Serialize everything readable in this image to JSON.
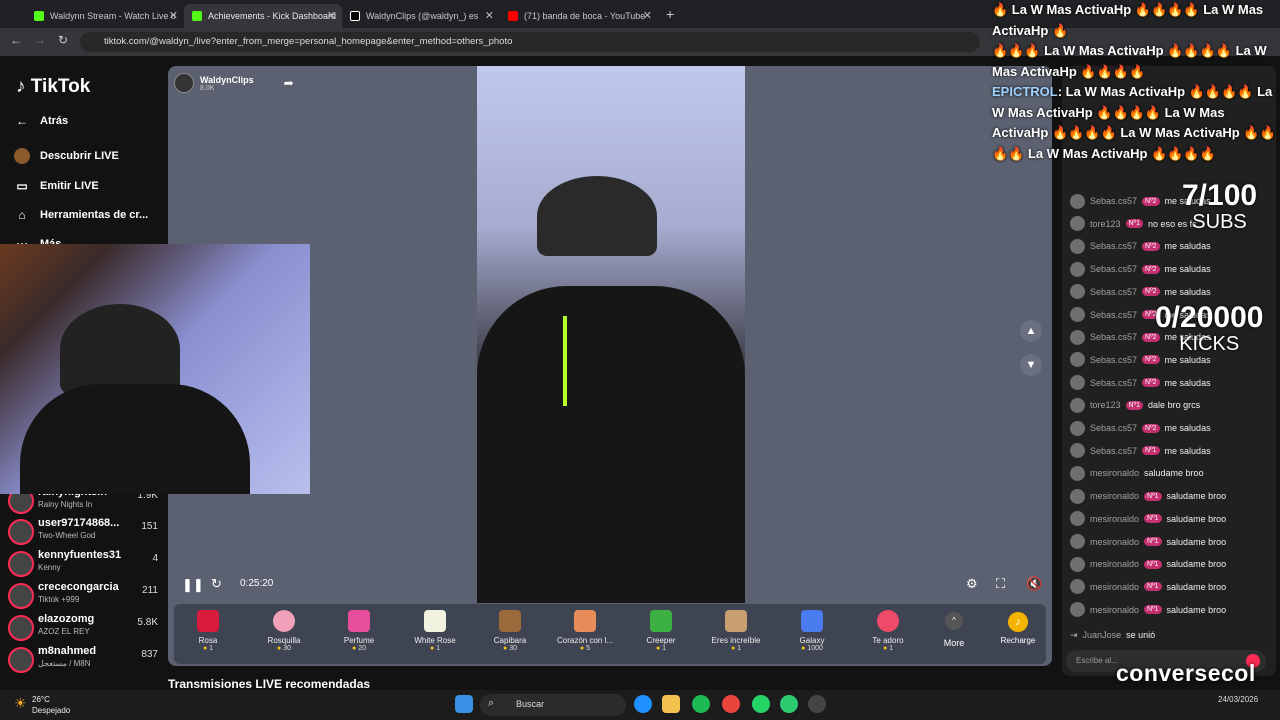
{
  "browser": {
    "tabs": [
      {
        "title": "Waldynn Stream - Watch Live o",
        "active": false
      },
      {
        "title": "Achievements - Kick Dashboard",
        "active": true
      },
      {
        "title": "WaldynClips (@waldyn_) es",
        "active": false
      },
      {
        "title": "(71) banda de boca - YouTube",
        "active": false
      }
    ],
    "url": "tiktok.com/@waldyn_/live?enter_from_merge=personal_homepage&enter_method=others_photo"
  },
  "sidebar": {
    "logo": "TikTok",
    "back": "Atrás",
    "items": [
      {
        "label": "Descubrir LIVE",
        "icon": "avatar-icon"
      },
      {
        "label": "Emitir LIVE",
        "icon": "camera-icon"
      },
      {
        "label": "Herramientas de cr...",
        "icon": "home-icon"
      },
      {
        "label": "Más",
        "icon": "more-icon"
      }
    ],
    "viewers": [
      {
        "name": "rainynightsin",
        "sub": "Rainy Nights In",
        "count": "1.9K"
      },
      {
        "name": "user97174868...",
        "sub": "Two-Wheel God",
        "count": "151"
      },
      {
        "name": "kennyfuentes31",
        "sub": "Kenny",
        "count": "4"
      },
      {
        "name": "crececongarcia",
        "sub": "Tiktok +999",
        "count": "211"
      },
      {
        "name": "elazozomg",
        "sub": "AZOZ EL REY",
        "count": "5.8K"
      },
      {
        "name": "m8nahmed",
        "sub": "مستعجل / M8N",
        "count": "837"
      }
    ]
  },
  "streamer": {
    "name": "WaldynClips",
    "followers": "8.0K"
  },
  "player": {
    "time": "0:25:20"
  },
  "gifts": [
    {
      "name": "Rosa",
      "price": "1",
      "color": "#d81b3c"
    },
    {
      "name": "Rosquilla",
      "price": "30",
      "color": "#f0a0b8"
    },
    {
      "name": "Perfume",
      "price": "20",
      "color": "#e84d9c"
    },
    {
      "name": "White Rose",
      "price": "1",
      "color": "#f2f2e0"
    },
    {
      "name": "Capibara",
      "price": "30",
      "color": "#9a6a3a"
    },
    {
      "name": "Corazón con l...",
      "price": "5",
      "color": "#e88c5a"
    },
    {
      "name": "Creeper",
      "price": "1",
      "color": "#3cb043"
    },
    {
      "name": "Eres increíble",
      "price": "1",
      "color": "#c8a070"
    },
    {
      "name": "Galaxy",
      "price": "1000",
      "color": "#4a7cf0"
    },
    {
      "name": "Te adoro",
      "price": "1",
      "color": "#f04a6a"
    }
  ],
  "more_label": "More",
  "recharge_label": "Recharge",
  "recommended_title": "Transmisiones LIVE recomendadas",
  "chat": {
    "messages": [
      {
        "user": "Sebas.cs57",
        "badge": "Nº2",
        "text": "me saludas"
      },
      {
        "user": "tore123",
        "badge": "Nº1",
        "text": "no eso es fc"
      },
      {
        "user": "Sebas.cs57",
        "badge": "Nº2",
        "text": "me saludas"
      },
      {
        "user": "Sebas.cs57",
        "badge": "Nº2",
        "text": "me saludas"
      },
      {
        "user": "Sebas.cs57",
        "badge": "Nº2",
        "text": "me saludas"
      },
      {
        "user": "Sebas.cs57",
        "badge": "Nº2",
        "text": "me saludas"
      },
      {
        "user": "Sebas.cs57",
        "badge": "Nº2",
        "text": "me saludas"
      },
      {
        "user": "Sebas.cs57",
        "badge": "Nº2",
        "text": "me saludas"
      },
      {
        "user": "Sebas.cs57",
        "badge": "Nº2",
        "text": "me saludas"
      },
      {
        "user": "tore123",
        "badge": "Nº1",
        "text": "dale bro grcs"
      },
      {
        "user": "Sebas.cs57",
        "badge": "Nº2",
        "text": "me saludas"
      },
      {
        "user": "Sebas.cs57",
        "badge": "Nº1",
        "text": "me saludas"
      },
      {
        "user": "mesironaldo",
        "badge": "",
        "text": "saludame broo"
      },
      {
        "user": "mesironaldo",
        "badge": "Nº1",
        "text": "saludame broo"
      },
      {
        "user": "mesironaldo",
        "badge": "Nº1",
        "text": "saludame broo"
      },
      {
        "user": "mesironaldo",
        "badge": "Nº1",
        "text": "saludame broo"
      },
      {
        "user": "mesironaldo",
        "badge": "Nº1",
        "text": "saludame broo"
      },
      {
        "user": "mesironaldo",
        "badge": "Nº1",
        "text": "saludame broo"
      },
      {
        "user": "mesironaldo",
        "badge": "Nº1",
        "text": "saludame broo"
      }
    ],
    "join": {
      "user": "JuanJose",
      "text": "se unió"
    },
    "input_placeholder": "Escribe al..."
  },
  "overlay": {
    "notification_lines": [
      "🔥 La W Mas ActivaHp 🔥🔥🔥🔥 La W Mas ActivaHp 🔥",
      "🔥🔥🔥 La W Mas ActivaHp 🔥🔥🔥🔥 La W Mas ActivaHp 🔥🔥🔥🔥"
    ],
    "epic_user": "EPICTROL",
    "epic_text": ": La W Mas ActivaHp 🔥🔥🔥🔥 La W Mas ActivaHp 🔥🔥🔥🔥 La W Mas ActivaHp 🔥🔥🔥🔥 La W Mas ActivaHp 🔥🔥🔥🔥 La W Mas ActivaHp 🔥🔥🔥🔥",
    "subs_count": "7/100",
    "subs_label": "SUBS",
    "kicks_count": "0/20000",
    "kicks_label": "KICKS",
    "brand": "conversecol"
  },
  "taskbar": {
    "weather_temp": "26°C",
    "weather_desc": "Despejado",
    "search": "Buscar",
    "date": "24/03/2026"
  }
}
